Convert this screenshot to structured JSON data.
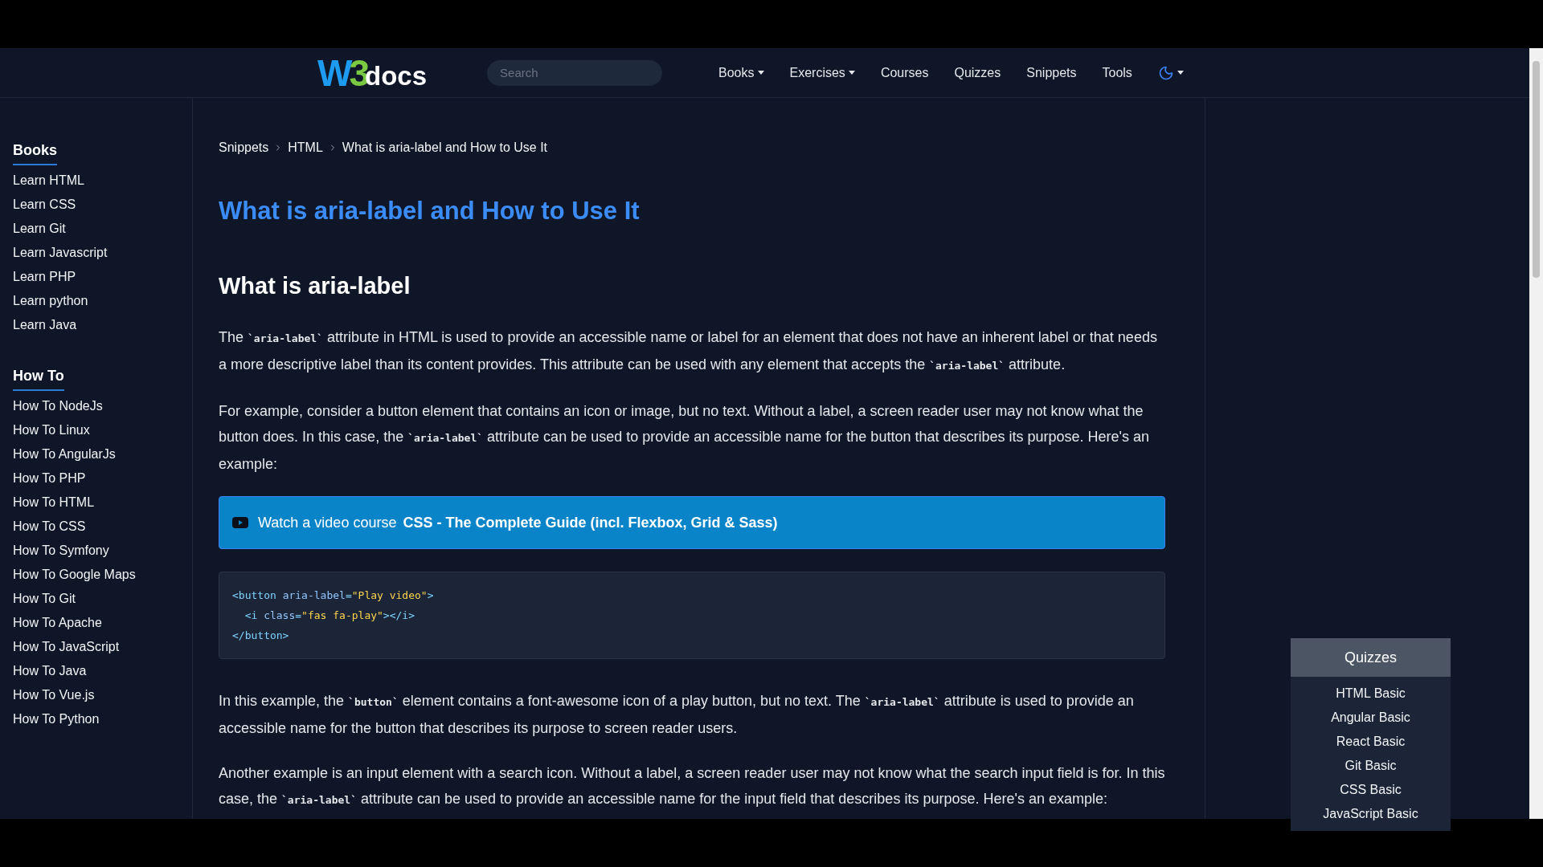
{
  "header": {
    "logo": {
      "mark_w": "W",
      "mark_3": "3",
      "text": "docs"
    },
    "search": {
      "placeholder": "Search"
    },
    "nav": [
      {
        "label": "Books",
        "dropdown": true
      },
      {
        "label": "Exercises",
        "dropdown": true
      },
      {
        "label": "Courses",
        "dropdown": false
      },
      {
        "label": "Quizzes",
        "dropdown": false
      },
      {
        "label": "Snippets",
        "dropdown": false
      },
      {
        "label": "Tools",
        "dropdown": false
      }
    ],
    "theme_toggle": {
      "dark": true,
      "dropdown": true
    }
  },
  "sidebar": {
    "sections": [
      {
        "title": "Books",
        "items": [
          "Learn HTML",
          "Learn CSS",
          "Learn Git",
          "Learn Javascript",
          "Learn PHP",
          "Learn python",
          "Learn Java"
        ]
      },
      {
        "title": "How To",
        "items": [
          "How To NodeJs",
          "How To Linux",
          "How To AngularJs",
          "How To PHP",
          "How To HTML",
          "How To CSS",
          "How To Symfony",
          "How To Google Maps",
          "How To Git",
          "How To Apache",
          "How To JavaScript",
          "How To Java",
          "How To Vue.js",
          "How To Python"
        ]
      }
    ]
  },
  "breadcrumb": [
    "Snippets",
    "HTML",
    "What is aria-label and How to Use It"
  ],
  "title": "What is aria-label and How to Use It",
  "section_heading": "What is aria-label",
  "blocks": [
    {
      "kind": "paragraph",
      "segments": [
        {
          "kind": "text",
          "text": "The "
        },
        {
          "kind": "code",
          "text": "`aria-label`"
        },
        {
          "kind": "text",
          "text": " attribute in HTML is used to provide an accessible name or label for an element that does not have an inherent label or that needs a more descriptive label than its content provides. This attribute can be used with any element that accepts the "
        },
        {
          "kind": "code",
          "text": "`aria-label`"
        },
        {
          "kind": "text",
          "text": " attribute."
        }
      ]
    },
    {
      "kind": "paragraph",
      "segments": [
        {
          "kind": "text",
          "text": "For example, consider a button element that contains an icon or image, but no text. Without a label, a screen reader user may not know what the button does. In this case, the "
        },
        {
          "kind": "code",
          "text": "`aria-label`"
        },
        {
          "kind": "text",
          "text": " attribute can be used to provide an accessible name for the button that describes its purpose. Here's an example:"
        }
      ]
    },
    {
      "kind": "banner",
      "prefix": "Watch a video course",
      "link": "CSS - The Complete Guide (incl. Flexbox, Grid & Sass)"
    },
    {
      "kind": "code_block",
      "lines": [
        [
          {
            "kind": "tag",
            "text": "<button "
          },
          {
            "kind": "attr",
            "text": "aria-label"
          },
          {
            "kind": "tag",
            "text": "="
          },
          {
            "kind": "string",
            "text": "\"Play video\""
          },
          {
            "kind": "tag",
            "text": ">"
          }
        ],
        [
          {
            "kind": "tag",
            "text": "  <i "
          },
          {
            "kind": "attr",
            "text": "class"
          },
          {
            "kind": "tag",
            "text": "="
          },
          {
            "kind": "string",
            "text": "\"fas fa-play\""
          },
          {
            "kind": "tag",
            "text": "></i>"
          }
        ],
        [
          {
            "kind": "tag",
            "text": "</button>"
          }
        ]
      ]
    },
    {
      "kind": "paragraph",
      "segments": [
        {
          "kind": "text",
          "text": "In this example, the "
        },
        {
          "kind": "code",
          "text": "`button`"
        },
        {
          "kind": "text",
          "text": " element contains a font-awesome icon of a play button, but no text. The "
        },
        {
          "kind": "code",
          "text": "`aria-label`"
        },
        {
          "kind": "text",
          "text": " attribute is used to provide an accessible name for the button that describes its purpose to screen reader users."
        }
      ]
    },
    {
      "kind": "paragraph",
      "segments": [
        {
          "kind": "text",
          "text": "Another example is an input element with a search icon. Without a label, a screen reader user may not know what the search input field is for. In this case, the "
        },
        {
          "kind": "code",
          "text": "`aria-label`"
        },
        {
          "kind": "text",
          "text": " attribute can be used to provide an accessible name for the input field that describes its purpose. Here's an example:"
        }
      ]
    }
  ],
  "quizzes": {
    "title": "Quizzes",
    "items": [
      "HTML Basic",
      "Angular Basic",
      "React Basic",
      "Git Basic",
      "CSS Basic",
      "JavaScript Basic"
    ]
  }
}
